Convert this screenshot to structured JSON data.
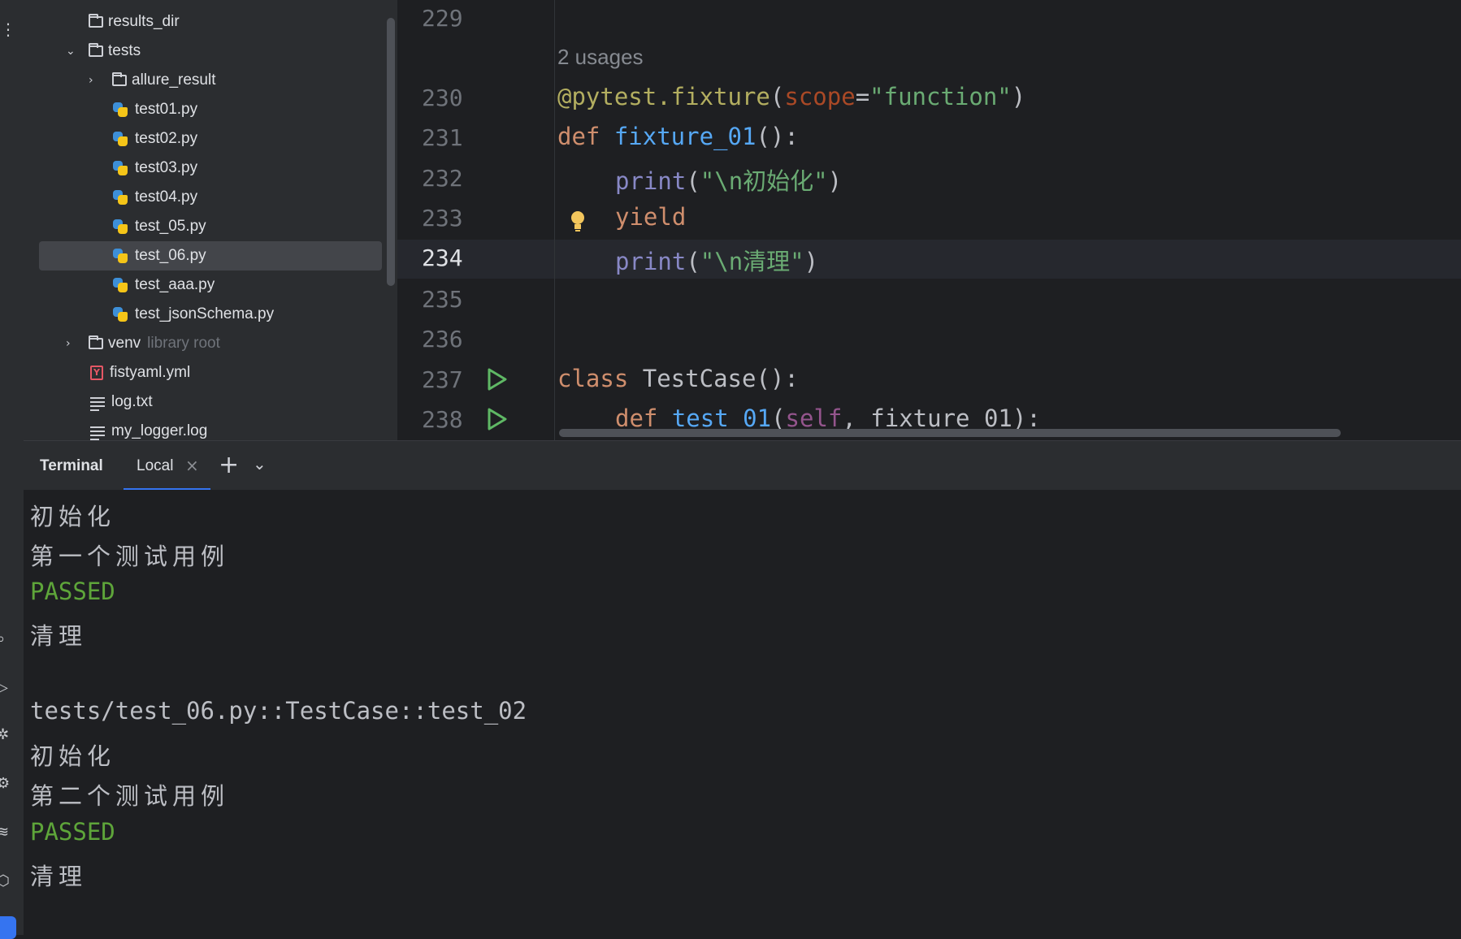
{
  "project_tree": {
    "items": [
      {
        "label": "results_dir",
        "type": "folder"
      },
      {
        "label": "tests",
        "type": "folder",
        "expanded": true
      },
      {
        "label": "allure_result",
        "type": "folder"
      },
      {
        "label": "test01.py",
        "type": "python"
      },
      {
        "label": "test02.py",
        "type": "python"
      },
      {
        "label": "test03.py",
        "type": "python"
      },
      {
        "label": "test04.py",
        "type": "python"
      },
      {
        "label": "test_05.py",
        "type": "python"
      },
      {
        "label": "test_06.py",
        "type": "python",
        "selected": true
      },
      {
        "label": "test_aaa.py",
        "type": "python"
      },
      {
        "label": "test_jsonSchema.py",
        "type": "python"
      },
      {
        "label": "venv",
        "type": "folder",
        "hint": "library root"
      },
      {
        "label": "fistyaml.yml",
        "type": "yaml",
        "icon_letter": "Y"
      },
      {
        "label": "log.txt",
        "type": "text"
      },
      {
        "label": "my_logger.log",
        "type": "text"
      }
    ]
  },
  "editor": {
    "usages": "2 usages",
    "lines": [
      {
        "num": "229"
      },
      {
        "num": "230",
        "tokens": [
          "@pytest.fixture",
          "(",
          "scope",
          "=",
          "\"function\"",
          ")"
        ]
      },
      {
        "num": "231",
        "tokens": [
          "def ",
          "fixture_01",
          "():"
        ]
      },
      {
        "num": "232",
        "tokens": [
          "print",
          "(",
          "\"\\n初始化\"",
          ")"
        ]
      },
      {
        "num": "233",
        "tokens": [
          "yield"
        ]
      },
      {
        "num": "234",
        "tokens": [
          "print",
          "(",
          "\"\\n清理\"",
          ")"
        ]
      },
      {
        "num": "235"
      },
      {
        "num": "236"
      },
      {
        "num": "237",
        "tokens": [
          "class ",
          "TestCase",
          "():"
        ]
      },
      {
        "num": "238",
        "tokens": [
          "def ",
          "test_01",
          "(",
          "self",
          ", fixture_01):"
        ]
      }
    ]
  },
  "terminal": {
    "title": "Terminal",
    "tab_label": "Local",
    "close_glyph": "×",
    "plus_glyph": "+",
    "chevron_glyph": "⌄",
    "lines": [
      "初始化",
      "第一个测试用例",
      "PASSED",
      "清理",
      "",
      "tests/test_06.py::TestCase::test_02",
      "初始化",
      "第二个测试用例",
      "PASSED",
      "清理"
    ]
  },
  "icons": {
    "accent": "#3574f0",
    "pass_color": "#5ea53a"
  }
}
